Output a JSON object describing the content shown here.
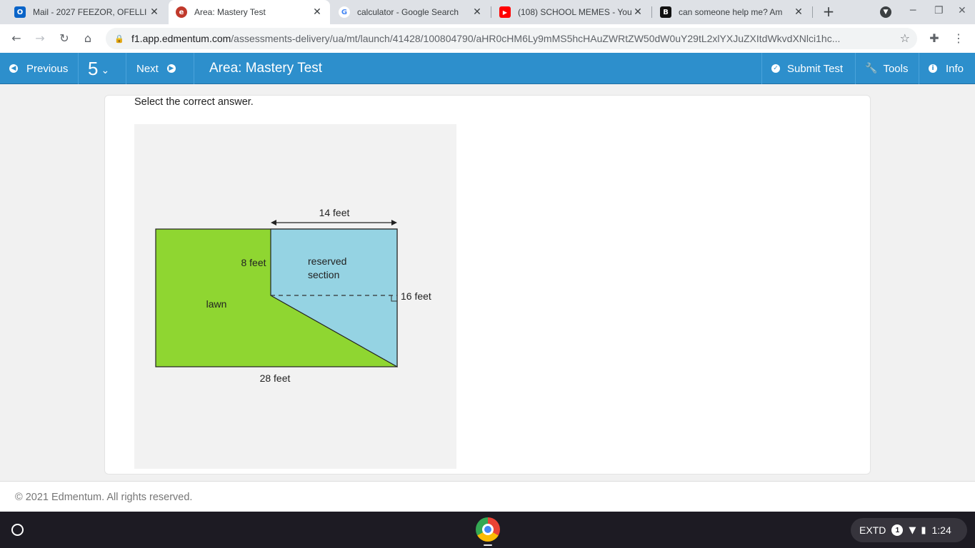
{
  "browser": {
    "tabs": [
      {
        "title": "Mail - 2027 FEEZOR, OFELLI",
        "icon": "outlook-icon",
        "fav": "O",
        "color": "#0a64c8"
      },
      {
        "title": "Area: Mastery Test",
        "icon": "edmentum-icon",
        "fav": "e",
        "color": "#c0392b"
      },
      {
        "title": "calculator - Google Search",
        "icon": "google-icon",
        "fav": "G",
        "color": "#4285f4"
      },
      {
        "title": "(108) SCHOOL MEMES - You",
        "icon": "youtube-icon",
        "fav": "▶",
        "color": "#ff0000"
      },
      {
        "title": "can someone help me? Am",
        "icon": "brainly-icon",
        "fav": "B",
        "color": "#111111"
      }
    ],
    "url_host": "f1.app.edmentum.com",
    "url_path": "/assessments-delivery/ua/mt/launch/41428/100804790/aHR0cHM6Ly9mMS5hcHAuZWRtZW50dW0uY29tL2xlYXJuZXItdWkvdXNlci1hc..."
  },
  "app": {
    "previous_label": "Previous",
    "question_number": "5",
    "next_label": "Next",
    "test_title": "Area: Mastery Test",
    "submit_label": "Submit Test",
    "tools_label": "Tools",
    "info_label": "Info"
  },
  "question": {
    "prompt": "Select the correct answer.",
    "figure": {
      "label_top": "14 feet",
      "label_middle_left": "8 feet",
      "label_reserved_1": "reserved",
      "label_reserved_2": "section",
      "label_right": "16 feet",
      "label_lawn": "lawn",
      "label_bottom": "28 feet",
      "lawn_color": "#8fd631",
      "reserved_color": "#95d3e3"
    }
  },
  "footer": {
    "copyright": "© 2021 Edmentum. All rights reserved."
  },
  "shelf": {
    "ime": "EXTD",
    "notification_count": "1",
    "time": "1:24"
  }
}
